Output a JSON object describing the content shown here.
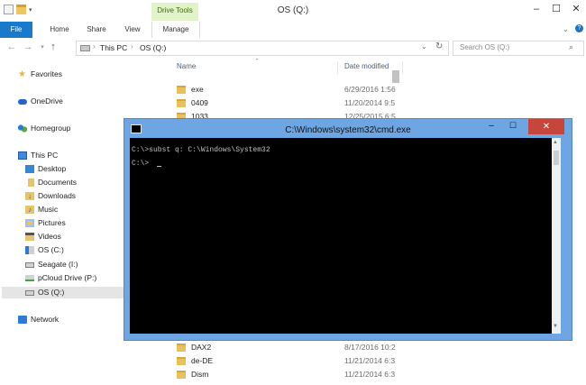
{
  "window": {
    "title": "OS (Q:)",
    "context_tab": "Drive Tools"
  },
  "ribbon": {
    "tabs": [
      "File",
      "Home",
      "Share",
      "View",
      "Manage"
    ]
  },
  "address": {
    "crumbs": [
      "This PC",
      "OS (Q:)"
    ],
    "search_placeholder": "Search OS (Q:)"
  },
  "nav_pane": {
    "items": [
      "Favorites",
      "OneDrive",
      "Homegroup",
      "This PC",
      "Desktop",
      "Documents",
      "Downloads",
      "Music",
      "Pictures",
      "Videos",
      "OS (C:)",
      "Seagate (I:)",
      "pCloud Drive (P:)",
      "OS (Q:)",
      "Network"
    ]
  },
  "file_list": {
    "columns": {
      "name": "Name",
      "date": "Date modified"
    },
    "rows_top": [
      {
        "name": "exe",
        "date": "6/29/2016 1:56"
      },
      {
        "name": "0409",
        "date": "11/20/2014 9:5"
      },
      {
        "name": "1033",
        "date": "12/25/2015 6:5"
      }
    ],
    "rows_bottom": [
      {
        "name": "DAX2",
        "date": "8/17/2016 10:2"
      },
      {
        "name": "de-DE",
        "date": "11/21/2014 6:3"
      },
      {
        "name": "Dism",
        "date": "11/21/2014 6:3"
      }
    ]
  },
  "cmd": {
    "title": "C:\\Windows\\system32\\cmd.exe",
    "lines": [
      "C:\\>subst q: C:\\Windows\\System32",
      "C:\\>"
    ]
  }
}
